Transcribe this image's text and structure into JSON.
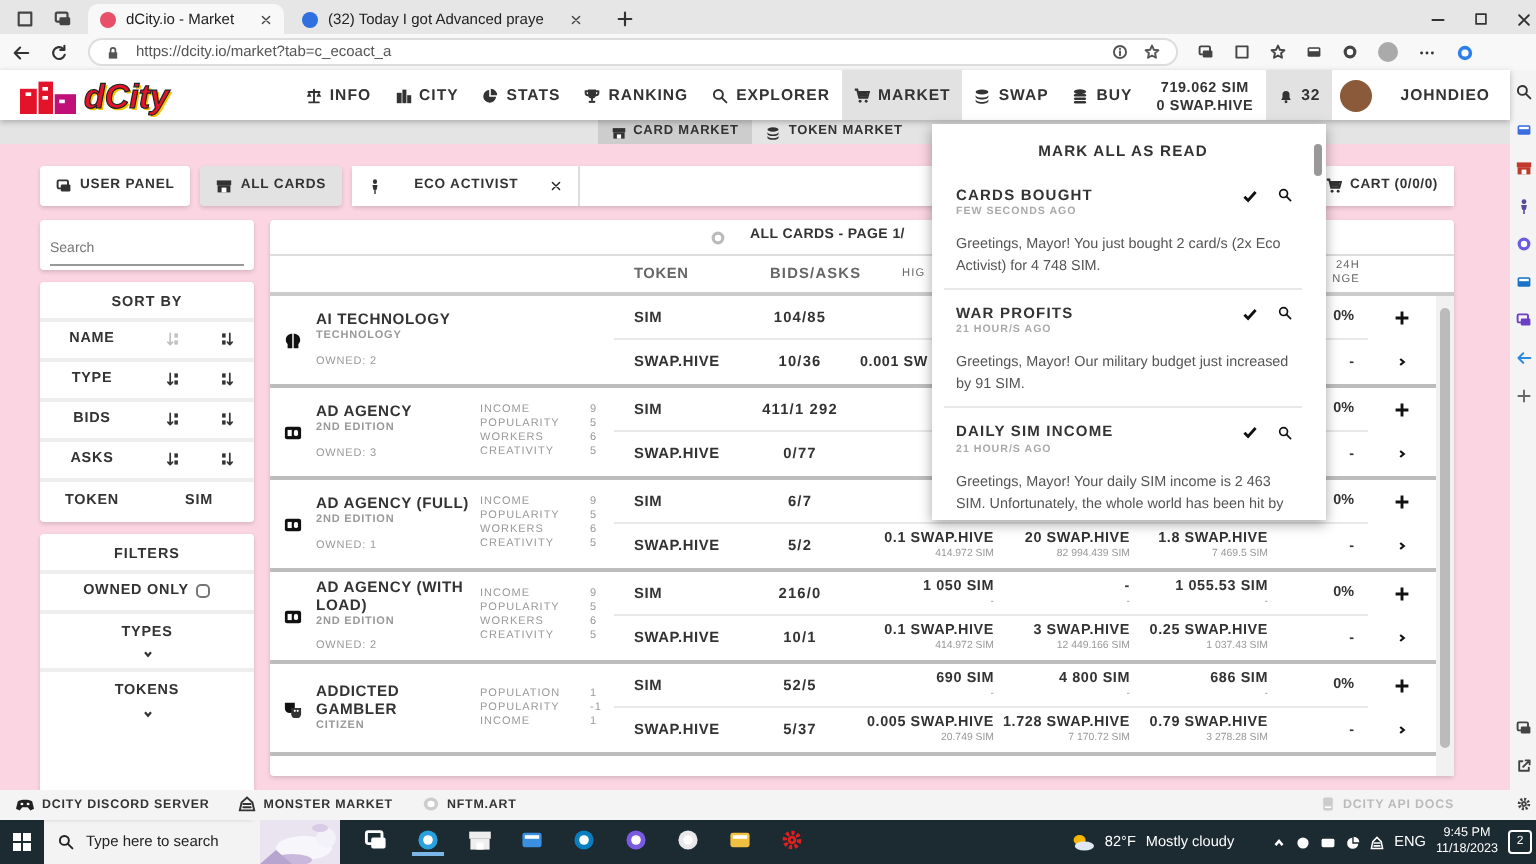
{
  "browser": {
    "tabs": [
      {
        "title": "dCity.io - Market",
        "selected": true
      },
      {
        "title": "(32) Today I got Advanced praye",
        "selected": false
      }
    ],
    "url": "https://dcity.io/market?tab=c_ecoact_a"
  },
  "navbar": {
    "logo": "dCity",
    "items": [
      {
        "label": "INFO",
        "selected": false
      },
      {
        "label": "CITY",
        "selected": false
      },
      {
        "label": "STATS",
        "selected": false
      },
      {
        "label": "RANKING",
        "selected": false
      },
      {
        "label": "EXPLORER",
        "selected": false
      },
      {
        "label": "MARKET",
        "selected": true
      },
      {
        "label": "SWAP",
        "selected": false
      },
      {
        "label": "BUY",
        "selected": false
      }
    ],
    "balance": [
      "719.062 SIM",
      "0 SWAP.HIVE"
    ],
    "notification_count": "32",
    "user": "JOHNDIEO"
  },
  "market_tabs": [
    {
      "label": "CARD MARKET",
      "selected": true
    },
    {
      "label": "TOKEN MARKET",
      "selected": false
    }
  ],
  "filter_tabs": [
    {
      "label": "USER PANEL",
      "selected": false
    },
    {
      "label": "ALL CARDS",
      "selected": true
    },
    {
      "label": "ECO ACTIVIST",
      "selected": false
    }
  ],
  "cart": "CART (0/0/0)",
  "sidebar": {
    "search": {
      "placeholder": "Search"
    },
    "sort_title": "SORT BY",
    "sort": [
      {
        "label": "NAME",
        "ascending_active": false
      },
      {
        "label": "TYPE",
        "ascending_active": true
      },
      {
        "label": "BIDS",
        "ascending_active": true
      },
      {
        "label": "ASKS",
        "ascending_active": true
      }
    ],
    "token": {
      "label": "TOKEN",
      "value": "SIM"
    },
    "filters_title": "FILTERS",
    "owned_only": {
      "label": "OWNED ONLY",
      "checked": false
    },
    "groups": [
      {
        "label": "TYPES",
        "expanded": false
      },
      {
        "label": "TOKENS",
        "expanded": false
      }
    ]
  },
  "table": {
    "title": "ALL CARDS - PAGE 1/",
    "columns": {
      "token": "TOKEN",
      "bids_asks": "BIDS/ASKS",
      "column_3": "HIG",
      "column_6": [
        "24H",
        "NGE"
      ]
    },
    "rows": [
      {
        "kind": "technology",
        "name": "AI TECHNOLOGY",
        "subtitle": "TECHNOLOGY",
        "owned": "OWNED: 2",
        "stats": [],
        "lines": [
          {
            "token": "SIM",
            "bids_asks": "104/85",
            "change": "0%"
          },
          {
            "token": "SWAP.HIVE",
            "bids_asks": "10/36",
            "column_3": {
              "main": "0.001 SW",
              "clipped": true
            },
            "change": "-"
          }
        ]
      },
      {
        "kind": "ad",
        "name": "AD AGENCY",
        "subtitle": "2ND EDITION",
        "owned": "OWNED: 3",
        "stats": [
          {
            "label": "INCOME",
            "value": "9"
          },
          {
            "label": "POPULARITY",
            "value": "5"
          },
          {
            "label": "WORKERS",
            "value": "6"
          },
          {
            "label": "CREATIVITY",
            "value": "5"
          }
        ],
        "lines": [
          {
            "token": "SIM",
            "bids_asks": "411/1 292",
            "change": "0%"
          },
          {
            "token": "SWAP.HIVE",
            "bids_asks": "0/77",
            "change": "-"
          }
        ]
      },
      {
        "kind": "ad",
        "name": "AD AGENCY (FULL)",
        "subtitle": "2ND EDITION",
        "owned": "OWNED: 1",
        "stats": [
          {
            "label": "INCOME",
            "value": "9"
          },
          {
            "label": "POPULARITY",
            "value": "5"
          },
          {
            "label": "WORKERS",
            "value": "6"
          },
          {
            "label": "CREATIVITY",
            "value": "5"
          }
        ],
        "lines": [
          {
            "token": "SIM",
            "bids_asks": "6/7",
            "change": "0%"
          },
          {
            "token": "SWAP.HIVE",
            "bids_asks": "5/2",
            "column_3": {
              "main": "0.1 SWAP.HIVE",
              "sub": "414.972 SIM"
            },
            "column_4": {
              "main": "20 SWAP.HIVE",
              "sub": "82 994.439 SIM"
            },
            "column_5": {
              "main": "1.8 SWAP.HIVE",
              "sub": "7 469.5 SIM"
            },
            "change": "-"
          }
        ]
      },
      {
        "kind": "ad",
        "name": "AD AGENCY (WITH LOAD)",
        "subtitle": "2ND EDITION",
        "owned": "OWNED: 2",
        "stats": [
          {
            "label": "INCOME",
            "value": "9"
          },
          {
            "label": "POPULARITY",
            "value": "5"
          },
          {
            "label": "WORKERS",
            "value": "6"
          },
          {
            "label": "CREATIVITY",
            "value": "5"
          }
        ],
        "lines": [
          {
            "token": "SIM",
            "bids_asks": "216/0",
            "column_3": {
              "main": "1 050 SIM",
              "sub": "-"
            },
            "column_4": {
              "main": "-",
              "sub": "-"
            },
            "column_5": {
              "main": "1 055.53 SIM",
              "sub": "-"
            },
            "change": "0%"
          },
          {
            "token": "SWAP.HIVE",
            "bids_asks": "10/1",
            "column_3": {
              "main": "0.1 SWAP.HIVE",
              "sub": "414.972 SIM"
            },
            "column_4": {
              "main": "3 SWAP.HIVE",
              "sub": "12 449.166 SIM"
            },
            "column_5": {
              "main": "0.25 SWAP.HIVE",
              "sub": "1 037.43 SIM"
            },
            "change": "-"
          }
        ]
      },
      {
        "kind": "citizen",
        "name": "ADDICTED GAMBLER",
        "subtitle": "CITIZEN",
        "stats": [
          {
            "label": "POPULATION",
            "value": "1"
          },
          {
            "label": "POPULARITY",
            "value": "-1"
          },
          {
            "label": "INCOME",
            "value": "1"
          }
        ],
        "lines": [
          {
            "token": "SIM",
            "bids_asks": "52/5",
            "column_3": {
              "main": "690 SIM",
              "sub": "-"
            },
            "column_4": {
              "main": "4 800 SIM",
              "sub": "-"
            },
            "column_5": {
              "main": "686 SIM",
              "sub": "-"
            },
            "change": "0%"
          },
          {
            "token": "SWAP.HIVE",
            "bids_asks": "5/37",
            "column_3": {
              "main": "0.005 SWAP.HIVE",
              "sub": "20.749 SIM"
            },
            "column_4": {
              "main": "1.728 SWAP.HIVE",
              "sub": "7 170.72 SIM"
            },
            "column_5": {
              "main": "0.79 SWAP.HIVE",
              "sub": "3 278.28 SIM"
            },
            "change": "-"
          }
        ]
      }
    ]
  },
  "notifications": {
    "header": "MARK ALL AS READ",
    "items": [
      {
        "title": "CARDS BOUGHT",
        "time": "FEW SECONDS AGO",
        "text": "Greetings, Mayor! You just bought 2 card/s (2x Eco Activist) for 4 748 SIM."
      },
      {
        "title": "WAR PROFITS",
        "time": "21 HOUR/S AGO",
        "text": "Greetings, Mayor! Our military budget just increased by 91 SIM."
      },
      {
        "title": "DAILY SIM INCOME",
        "time": "21 HOUR/S AGO",
        "text": "Greetings, Mayor! Your daily SIM income is 2 463 SIM. Unfortunately, the whole world has been hit by"
      }
    ]
  },
  "footer": {
    "links": [
      "DCITY DISCORD SERVER",
      "MONSTER MARKET",
      "NFTM.ART"
    ],
    "api_docs": {
      "label": "DCITY API DOCS",
      "disabled": true
    }
  },
  "taskbar": {
    "search": {
      "placeholder": "Type here to search"
    },
    "temperature": "82°F",
    "weather": "Mostly cloudy",
    "language": "ENG",
    "time": "9:45 PM",
    "date": "11/18/2023",
    "notification_count": "2"
  }
}
